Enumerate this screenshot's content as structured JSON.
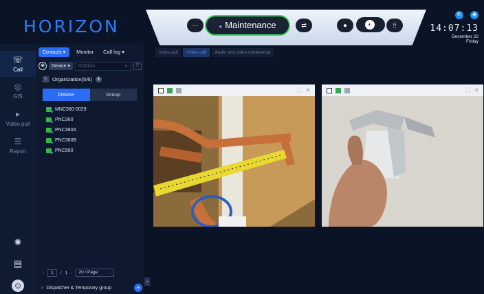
{
  "brand": "HORIZON",
  "nav": [
    {
      "label": "Call",
      "icon": "call-icon"
    },
    {
      "label": "GIS",
      "icon": "map-pin-icon"
    },
    {
      "label": "Video pull",
      "icon": "video-play-icon"
    },
    {
      "label": "Report",
      "icon": "report-icon"
    }
  ],
  "panel": {
    "tabs": {
      "contacts": "Contacts ▾",
      "monitor": "Monitor",
      "call_log": "Call log ▾"
    },
    "device_select": "Device ▾",
    "search_placeholder": "ID/Alias",
    "organization": "Organization(5/6)",
    "seg": {
      "device": "Device",
      "group": "Group"
    },
    "devices": [
      "MNC360-0029",
      "PNC360",
      "PNC380A",
      "PNC380B",
      "PNC560"
    ],
    "pager": {
      "page": "1",
      "sep": "/",
      "total": "1",
      "per_page": "20 / Page"
    },
    "dispatcher": "Dispatcher & Temporary group"
  },
  "topbar": {
    "status": "Maintenance"
  },
  "clock": {
    "time": "14:07:13",
    "date": "December 22",
    "day": "Friday"
  },
  "call_tabs": [
    "Voice call",
    "Video call",
    "Audio and video conference"
  ],
  "colors": {
    "accent": "#2a6df4",
    "status_ring": "#3ccf5a",
    "bg": "#0b1426"
  }
}
